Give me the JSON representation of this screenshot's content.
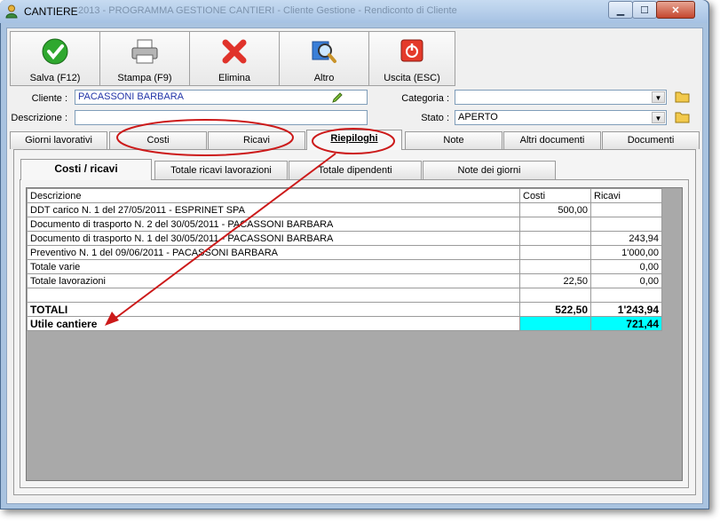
{
  "window": {
    "title": "CANTIERE",
    "title_ghost": "2013 - PROGRAMMA GESTIONE CANTIERI - Cliente Gestione - Rendiconto di Cliente"
  },
  "toolbar": {
    "save_label": "Salva (F12)",
    "print_label": "Stampa (F9)",
    "delete_label": "Elimina",
    "other_label": "Altro",
    "exit_label": "Uscita (ESC)"
  },
  "form": {
    "cliente_label": "Cliente :",
    "cliente_value": "PACASSONI BARBARA",
    "descrizione_label": "Descrizione :",
    "descrizione_value": "",
    "categoria_label": "Categoria :",
    "categoria_value": "",
    "stato_label": "Stato :",
    "stato_value": "APERTO"
  },
  "tabs": [
    {
      "label": "Giorni lavorativi"
    },
    {
      "label": "Costi"
    },
    {
      "label": "Ricavi"
    },
    {
      "label": "Riepiloghi"
    },
    {
      "label": "Note"
    },
    {
      "label": "Altri documenti"
    },
    {
      "label": "Documenti"
    }
  ],
  "subtabs": [
    {
      "label": "Costi / ricavi"
    },
    {
      "label": "Totale ricavi lavorazioni"
    },
    {
      "label": "Totale dipendenti"
    },
    {
      "label": "Note dei giorni"
    }
  ],
  "grid": {
    "headers": [
      "Descrizione",
      "Costi",
      "Ricavi"
    ],
    "rows": [
      [
        "DDT carico N. 1 del 27/05/2011 - ESPRINET SPA",
        "500,00",
        ""
      ],
      [
        "Documento di trasporto N. 2 del 30/05/2011 - PACASSONI BARBARA",
        "",
        ""
      ],
      [
        "Documento di trasporto N. 1 del 30/05/2011 - PACASSONI BARBARA",
        "",
        "243,94"
      ],
      [
        "Preventivo N. 1 del 09/06/2011 - PACASSONI BARBARA",
        "",
        "1'000,00"
      ],
      [
        "Totale varie",
        "",
        "0,00"
      ],
      [
        "Totale lavorazioni",
        "22,50",
        "0,00"
      ],
      [
        "",
        "",
        ""
      ]
    ],
    "totali": [
      "TOTALI",
      "522,50",
      "1'243,94"
    ],
    "utile": [
      "Utile cantiere",
      "",
      "721,44"
    ]
  },
  "colors": {
    "highlight": "#00ffff",
    "annotation": "#cc1a1a"
  },
  "icons": [
    "check-icon",
    "printer-icon",
    "delete-x-icon",
    "magnifier-icon",
    "power-icon",
    "pencil-icon",
    "folder-icon"
  ]
}
